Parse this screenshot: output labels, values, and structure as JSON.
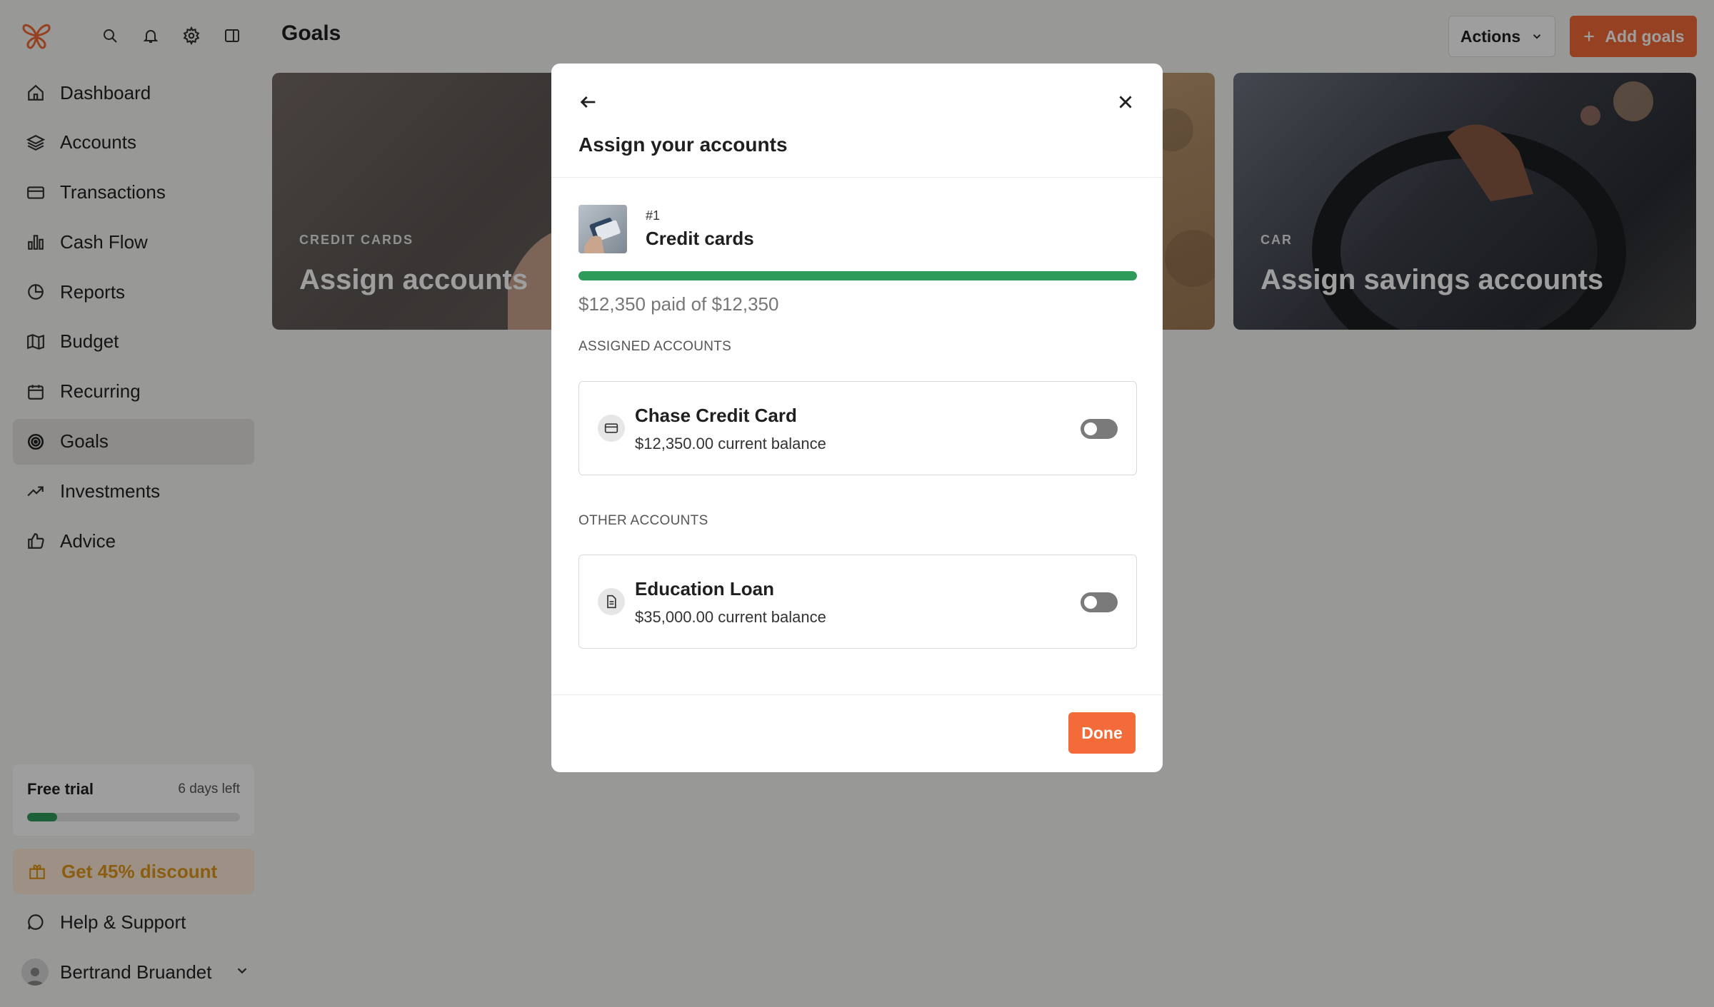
{
  "sidebar": {
    "items": [
      {
        "label": "Dashboard",
        "icon": "home-icon",
        "active": false
      },
      {
        "label": "Accounts",
        "icon": "layers-icon",
        "active": false
      },
      {
        "label": "Transactions",
        "icon": "card-icon",
        "active": false
      },
      {
        "label": "Cash Flow",
        "icon": "bar-chart-icon",
        "active": false
      },
      {
        "label": "Reports",
        "icon": "pie-chart-icon",
        "active": false
      },
      {
        "label": "Budget",
        "icon": "map-icon",
        "active": false
      },
      {
        "label": "Recurring",
        "icon": "calendar-icon",
        "active": false
      },
      {
        "label": "Goals",
        "icon": "target-icon",
        "active": true
      },
      {
        "label": "Investments",
        "icon": "trend-up-icon",
        "active": false
      },
      {
        "label": "Advice",
        "icon": "thumbs-up-icon",
        "active": false
      }
    ],
    "trial": {
      "label": "Free trial",
      "days_left": "6 days left",
      "progress": 0.14
    },
    "discount": "Get 45% discount",
    "help": "Help & Support",
    "user": "Bertrand Bruandet"
  },
  "header": {
    "title": "Goals",
    "actions_label": "Actions",
    "add_label": "Add goals"
  },
  "cards": [
    {
      "label": "CREDIT CARDS",
      "title": "Assign accounts"
    },
    {
      "label": "",
      "title": ""
    },
    {
      "label": "CAR",
      "title": "Assign savings accounts"
    }
  ],
  "modal": {
    "title": "Assign your accounts",
    "goal": {
      "number": "#1",
      "name": "Credit cards",
      "progress": 1.0,
      "paid_text": "$12,350 paid of $12,350"
    },
    "assigned_heading": "ASSIGNED ACCOUNTS",
    "other_heading": "OTHER ACCOUNTS",
    "assigned": [
      {
        "name": "Chase Credit Card",
        "balance": "$12,350.00 current balance",
        "icon": "credit-card-icon"
      }
    ],
    "other": [
      {
        "name": "Education Loan",
        "balance": "$35,000.00 current balance",
        "icon": "document-icon"
      }
    ],
    "done_label": "Done"
  },
  "colors": {
    "accent": "#f26b38",
    "progress": "#2e9b5b",
    "discount": "#e0961a"
  }
}
